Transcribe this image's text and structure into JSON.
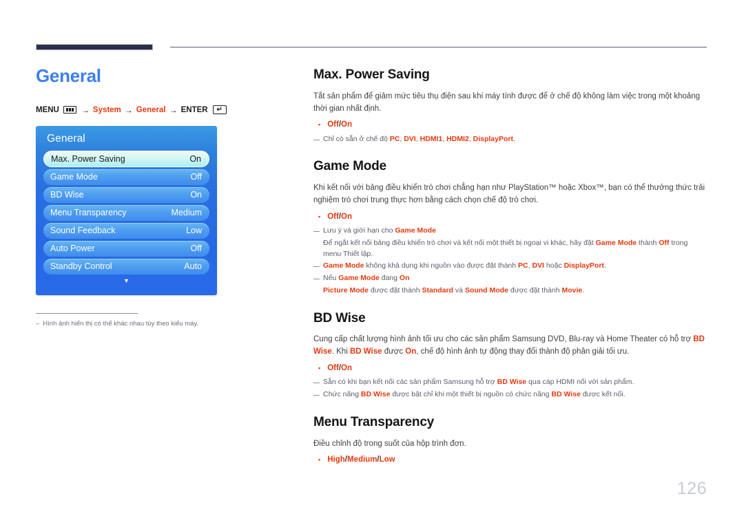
{
  "header": {
    "rule_color": "#2b3048"
  },
  "left": {
    "chapter_title": "General",
    "breadcrumb": {
      "menu_label": "MENU",
      "menu_icon": "menu-bars-icon",
      "arrow1": "→",
      "item1": "System",
      "arrow2": "→",
      "item2": "General",
      "arrow3": "→",
      "enter_label": "ENTER",
      "enter_icon": "enter-return-icon",
      "enter_glyph": "↵",
      "accent_color": "#e8380d"
    },
    "osd": {
      "title": "General",
      "rows": [
        {
          "label": "Max. Power Saving",
          "value": "On",
          "selected": true
        },
        {
          "label": "Game Mode",
          "value": "Off",
          "selected": false
        },
        {
          "label": "BD Wise",
          "value": "On",
          "selected": false
        },
        {
          "label": "Menu Transparency",
          "value": "Medium",
          "selected": false
        },
        {
          "label": "Sound Feedback",
          "value": "Low",
          "selected": false
        },
        {
          "label": "Auto Power",
          "value": "Off",
          "selected": false
        },
        {
          "label": "Standby Control",
          "value": "Auto",
          "selected": false
        }
      ],
      "scroll_down_icon": "chevron-down-icon",
      "scroll_down_glyph": "▼"
    },
    "footnote": {
      "dash": "–",
      "text": "Hình ảnh hiển thị có thể khác nhau tùy theo kiểu máy."
    }
  },
  "sections": {
    "max_power_saving": {
      "title": "Max. Power Saving",
      "body": "Tắt sản phẩm để giảm mức tiêu thụ điện sau khi máy tính được để ở chế độ không làm việc trong một khoảng thời gian nhất định.",
      "bullet_options": "Off / On",
      "bullet_opt_1": "Off",
      "bullet_sep": "/",
      "bullet_opt_2": "On",
      "note_1_pre": "Chỉ có sẵn ở chế độ ",
      "note_1_t1": "PC",
      "note_1_c1": ", ",
      "note_1_t2": "DVI",
      "note_1_c2": ", ",
      "note_1_t3": "HDMI1",
      "note_1_c3": ", ",
      "note_1_t4": "HDMI2",
      "note_1_c4": ", ",
      "note_1_t5": "DisplayPort",
      "note_1_end": "."
    },
    "game_mode": {
      "title": "Game Mode",
      "body": "Khi kết nối với bảng điều khiển trò chơi chẳng hạn như PlayStation™ hoặc Xbox™, bạn có thể thưởng thức trải nghiệm trò chơi trung thực hơn bằng cách chọn chế độ trò chơi.",
      "bullet_opt_1": "Off",
      "bullet_sep": "/",
      "bullet_opt_2": "On",
      "note_1_pre": "Lưu ý và giới hạn cho ",
      "note_1_term": "Game Mode",
      "note_1_line2_pre": "Để ngắt kết nối bảng điều khiển trò chơi và kết nối một thiết bị ngoại vi khác, hãy đặt ",
      "note_1_line2_t1": "Game Mode",
      "note_1_line2_mid": " thành ",
      "note_1_line2_t2": "Off",
      "note_1_line2_end": " trong menu Thiết lập.",
      "note_2_t1": "Game Mode",
      "note_2_mid": " không khả dụng khi nguồn vào được đặt thành ",
      "note_2_t2": "PC",
      "note_2_c1": ", ",
      "note_2_t3": "DVI",
      "note_2_mid2": " hoặc ",
      "note_2_t4": "DisplayPort",
      "note_2_end": ".",
      "note_3_pre": "Nếu ",
      "note_3_t1": "Game Mode",
      "note_3_mid": " đang ",
      "note_3_t2": "On",
      "note_3_line2_t1": "Picture Mode",
      "note_3_line2_mid": " được đặt thành ",
      "note_3_line2_t2": "Standard",
      "note_3_line2_mid2": " và ",
      "note_3_line2_t3": "Sound Mode",
      "note_3_line2_mid3": " được đặt thành ",
      "note_3_line2_t4": "Movie",
      "note_3_line2_end": "."
    },
    "bd_wise": {
      "title": "BD Wise",
      "body_pre": "Cung cấp chất lượng hình ảnh tối ưu cho các sản phẩm Samsung DVD, Blu-ray và Home Theater có hỗ trợ ",
      "body_t1": "BD Wise",
      "body_mid": ". Khi ",
      "body_t2": "BD Wise",
      "body_mid2": " được ",
      "body_t3": "On",
      "body_end": ", chế độ hình ảnh tự động thay đổi thành độ phân giải tối ưu.",
      "bullet_opt_1": "Off",
      "bullet_sep": "/",
      "bullet_opt_2": "On",
      "note_1_pre": "Sẵn có khi bạn kết nối các sản phẩm Samsung hỗ trợ ",
      "note_1_t1": "BD Wise",
      "note_1_end": " qua cáp HDMI nối với sản phẩm.",
      "note_2_pre": "Chức năng ",
      "note_2_t1": "BD Wise",
      "note_2_mid": " được bật chỉ khi một thiết bị nguồn có chức năng ",
      "note_2_t2": "BD Wise",
      "note_2_end": " được kết nối."
    },
    "menu_transparency": {
      "title": "Menu Transparency",
      "body": "Điều chỉnh độ trong suốt của hộp trình đơn.",
      "bullet_opt_1": "High",
      "bullet_sep_1": "/",
      "bullet_opt_2": "Medium",
      "bullet_sep_2": "/",
      "bullet_opt_3": "Low"
    }
  },
  "page_number": "126"
}
